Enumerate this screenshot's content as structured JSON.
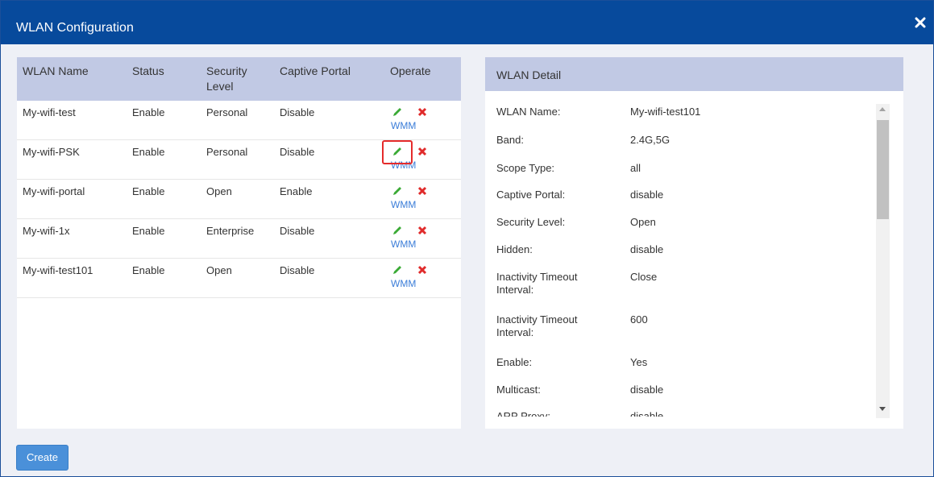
{
  "dialog": {
    "title": "WLAN Configuration",
    "close_icon": "close-icon"
  },
  "table": {
    "headers": [
      "WLAN Name",
      "Status",
      "Security\nLevel",
      "Captive Portal",
      "Operate"
    ],
    "header_security_line1": "Security",
    "header_security_line2": "Level",
    "rows": [
      {
        "name": "My-wifi-test",
        "status": "Enable",
        "security": "Personal",
        "portal": "Disable",
        "wmm": "WMM"
      },
      {
        "name": "My-wifi-PSK",
        "status": "Enable",
        "security": "Personal",
        "portal": "Disable",
        "wmm": "WMM"
      },
      {
        "name": "My-wifi-portal",
        "status": "Enable",
        "security": "Open",
        "portal": "Enable",
        "wmm": "WMM"
      },
      {
        "name": "My-wifi-1x",
        "status": "Enable",
        "security": "Enterprise",
        "portal": "Disable",
        "wmm": "WMM"
      },
      {
        "name": "My-wifi-test101",
        "status": "Enable",
        "security": "Open",
        "portal": "Disable",
        "wmm": "WMM"
      }
    ],
    "icons": {
      "edit": "pencil-icon",
      "delete": "delete-x-icon"
    }
  },
  "detail": {
    "title": "WLAN Detail",
    "items": [
      {
        "label": "WLAN Name:",
        "value": "My-wifi-test101"
      },
      {
        "label": "Band:",
        "value": "2.4G,5G"
      },
      {
        "label": "Scope Type:",
        "value": "all"
      },
      {
        "label": "Captive Portal:",
        "value": "disable"
      },
      {
        "label": "Security Level:",
        "value": "Open"
      },
      {
        "label": "Hidden:",
        "value": "disable"
      },
      {
        "label": "Inactivity Timeout Interval:",
        "value": "Close"
      },
      {
        "label": "Inactivity Timeout Interval:",
        "value": "600"
      },
      {
        "label": "Enable:",
        "value": "Yes"
      },
      {
        "label": "Multicast:",
        "value": "disable"
      },
      {
        "label": "ARP Proxy:",
        "value": "disable"
      }
    ]
  },
  "actions": {
    "create_label": "Create"
  },
  "colors": {
    "titlebar": "#074a9c",
    "header": "#c1c9e4",
    "edit": "#3aaa35",
    "delete": "#e02b2b",
    "link": "#3b7dd8",
    "highlight": "#e52b2b"
  }
}
